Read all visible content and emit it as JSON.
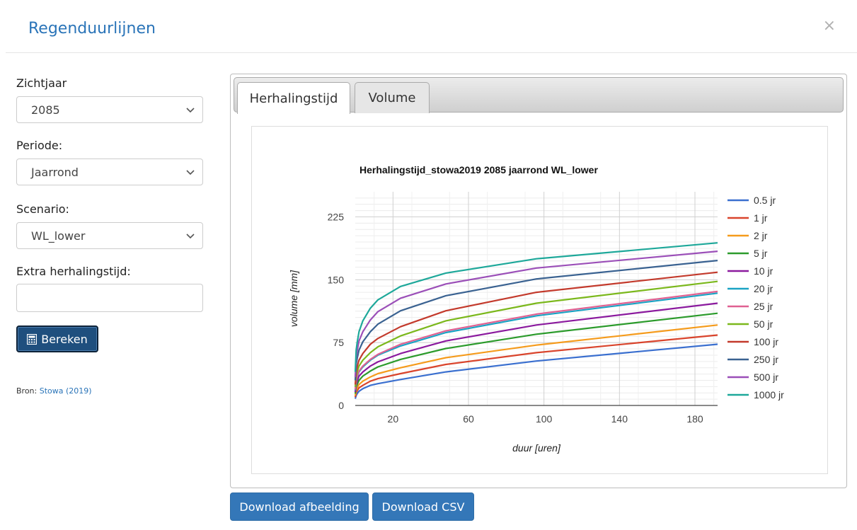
{
  "modal": {
    "title": "Regenduurlijnen",
    "close_label": "×"
  },
  "form": {
    "zichtjaar_label": "Zichtjaar",
    "zichtjaar_value": "2085",
    "periode_label": "Periode:",
    "periode_value": "Jaarrond",
    "scenario_label": "Scenario:",
    "scenario_value": "WL_lower",
    "extra_label": "Extra herhalingstijd:",
    "extra_value": "",
    "calc_label": "Bereken"
  },
  "source": {
    "prefix": "Bron:",
    "link": "Stowa (2019)"
  },
  "tabs": [
    {
      "label": "Herhalingstijd",
      "active": true
    },
    {
      "label": "Volume",
      "active": false
    }
  ],
  "downloads": {
    "image_label": "Download afbeelding",
    "csv_label": "Download CSV"
  },
  "colors": {
    "accent": "#2a74b8",
    "button": "#3477b8"
  },
  "chart_data": {
    "type": "line",
    "title": "Herhalingstijd_stowa2019 2085 jaarrond WL_lower",
    "xlabel": "duur [uren]",
    "ylabel": "volume [mm]",
    "xticks": [
      20,
      60,
      100,
      140,
      180
    ],
    "yticks": [
      0,
      75,
      150,
      225
    ],
    "xlim": [
      0,
      192
    ],
    "ylim": [
      0,
      255
    ],
    "legend": "right",
    "x": [
      0,
      0.5,
      1,
      2,
      4,
      8,
      12,
      24,
      48,
      96,
      192
    ],
    "series": [
      {
        "name": "0.5 jr",
        "color": "#3a6fcf",
        "values": [
          8,
          12,
          14,
          17,
          20,
          24,
          26,
          31,
          40,
          53,
          73
        ]
      },
      {
        "name": "1 jr",
        "color": "#d9442c",
        "values": [
          10,
          15,
          17.5,
          21,
          24,
          29,
          32,
          38,
          49,
          63,
          84
        ]
      },
      {
        "name": "2 jr",
        "color": "#f59b1c",
        "values": [
          12,
          18,
          21,
          25,
          29,
          34,
          38,
          45,
          57,
          72,
          96
        ]
      },
      {
        "name": "5 jr",
        "color": "#2c9b2c",
        "values": [
          14,
          22,
          25,
          30,
          35,
          41,
          46,
          55,
          68,
          85,
          110
        ]
      },
      {
        "name": "10 jr",
        "color": "#8b1a9e",
        "values": [
          16,
          25,
          29,
          35,
          40,
          47,
          52,
          62,
          77,
          96,
          122
        ]
      },
      {
        "name": "20 jr",
        "color": "#1aa3c4",
        "values": [
          18,
          29,
          34,
          40,
          46,
          54,
          60,
          71,
          87,
          107,
          134
        ]
      },
      {
        "name": "25 jr",
        "color": "#e06191",
        "values": [
          19,
          30,
          35,
          41,
          47,
          55,
          61,
          73,
          89,
          109,
          136
        ]
      },
      {
        "name": "50 jr",
        "color": "#7bb81c",
        "values": [
          22,
          35,
          40,
          47,
          54,
          63,
          70,
          83,
          101,
          122,
          148
        ]
      },
      {
        "name": "100 jr",
        "color": "#c33a2c",
        "values": [
          25,
          40,
          46,
          54,
          62,
          73,
          80,
          94,
          113,
          135,
          159
        ]
      },
      {
        "name": "250 jr",
        "color": "#3a6291",
        "values": [
          30,
          49,
          56,
          66,
          76,
          88,
          97,
          113,
          131,
          151,
          173
        ]
      },
      {
        "name": "500 jr",
        "color": "#9b4fb8",
        "values": [
          34,
          57,
          65,
          77,
          88,
          102,
          112,
          128,
          145,
          164,
          184
        ]
      },
      {
        "name": "1000 jr",
        "color": "#1ea89a",
        "values": [
          40,
          66,
          75,
          88,
          101,
          116,
          126,
          142,
          158,
          175,
          194
        ]
      }
    ]
  }
}
